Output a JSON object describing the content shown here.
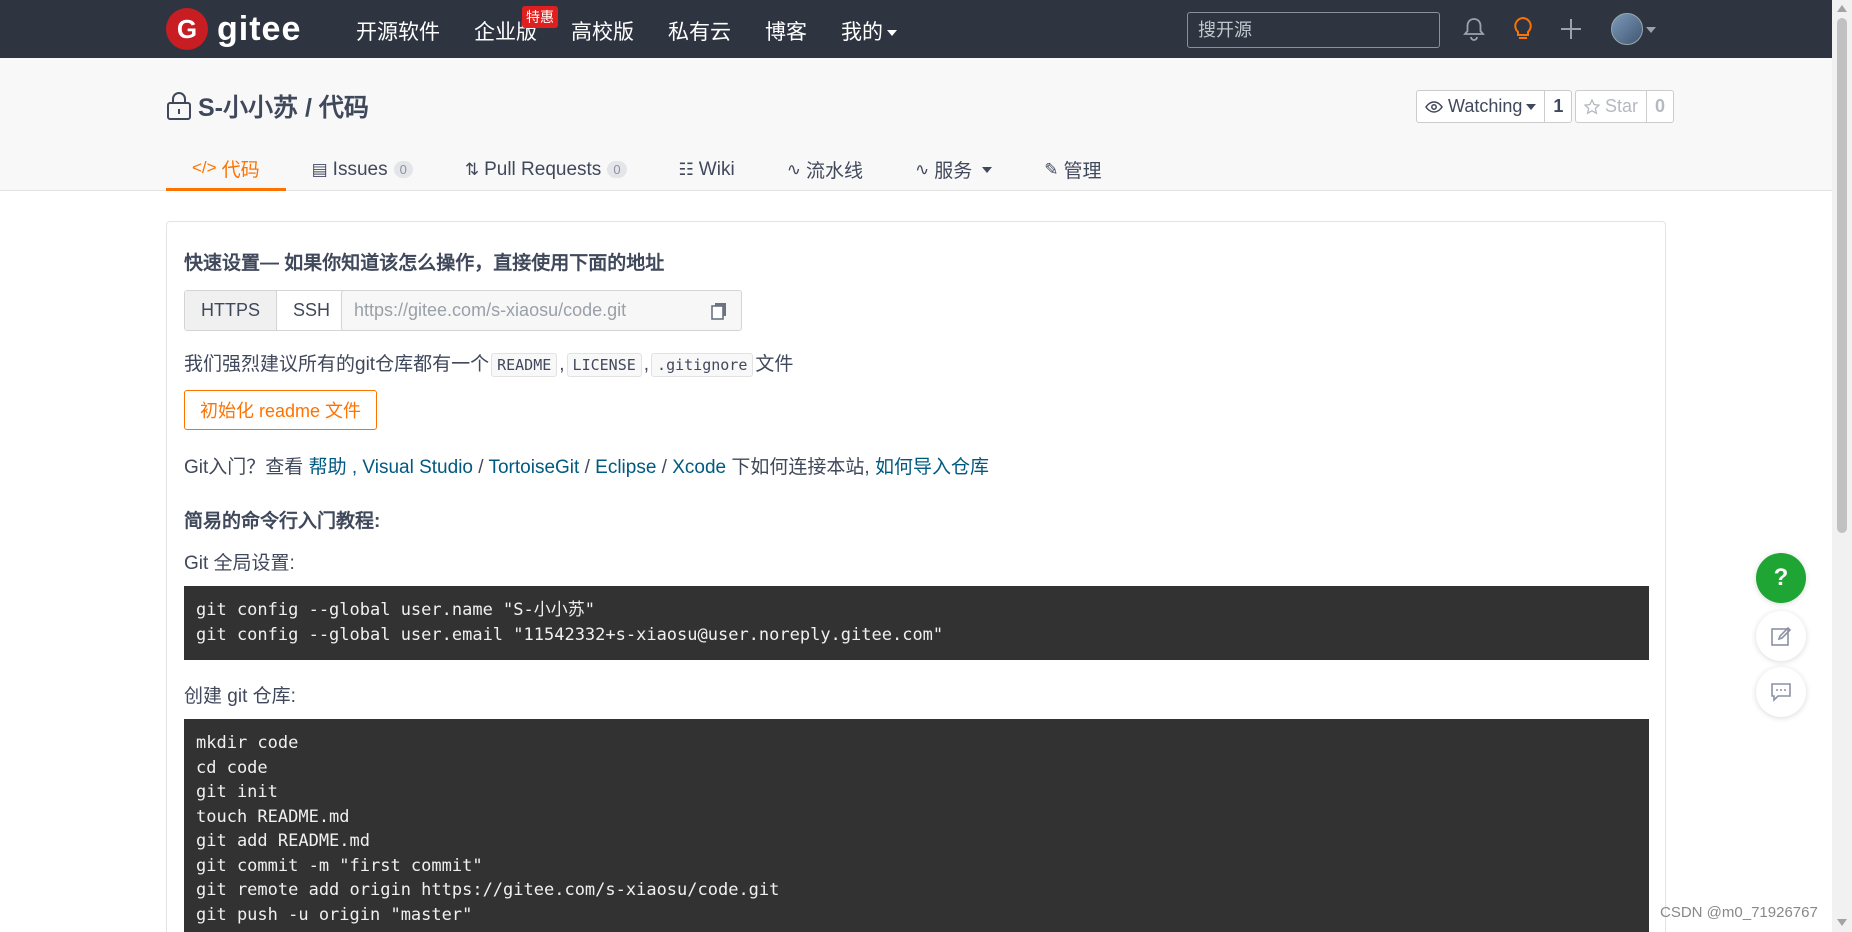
{
  "topnav": {
    "logo_text": "gitee",
    "logo_letter": "G",
    "links": [
      {
        "label": "开源软件"
      },
      {
        "label": "企业版",
        "badge": "特惠"
      },
      {
        "label": "高校版"
      },
      {
        "label": "私有云"
      },
      {
        "label": "博客"
      },
      {
        "label": "我的"
      }
    ],
    "search_placeholder": "搜开源"
  },
  "repo": {
    "title": "S-小小苏 / 代码",
    "watch_label": "Watching",
    "watch_count": "1",
    "star_label": "Star",
    "star_count": "0"
  },
  "tabs": [
    {
      "label": "代码",
      "icon": "code-icon",
      "active": true
    },
    {
      "label": "Issues",
      "count": "0",
      "icon": "issues-icon"
    },
    {
      "label": "Pull Requests",
      "count": "0",
      "icon": "pull-request-icon"
    },
    {
      "label": "Wiki",
      "icon": "wiki-icon"
    },
    {
      "label": "流水线",
      "icon": "pipeline-icon"
    },
    {
      "label": "服务",
      "icon": "service-icon"
    },
    {
      "label": "管理",
      "icon": "manage-icon"
    }
  ],
  "quick_setup": {
    "heading": "快速设置— 如果你知道该怎么操作，直接使用下面的地址",
    "https_label": "HTTPS",
    "ssh_label": "SSH",
    "url": "https://gitee.com/s-xiaosu/code.git",
    "recommend_prefix": "我们强烈建议所有的git仓库都有一个",
    "recommend_files": [
      "README",
      "LICENSE",
      ".gitignore"
    ],
    "recommend_suffix": "文件",
    "init_button": "初始化 readme 文件",
    "help_prefix": "Git入门？查看",
    "help_links": [
      "帮助",
      "Visual Studio",
      "TortoiseGit",
      "Eclipse",
      "Xcode"
    ],
    "help_mid": "下如何连接本站,",
    "import_link": "如何导入仓库"
  },
  "tutorial": {
    "heading": "简易的命令行入门教程:",
    "global_label": "Git 全局设置:",
    "global_lines": [
      "git config --global user.name \"S-小小苏\"",
      "git config --global user.email \"11542332+s-xiaosu@user.noreply.gitee.com\""
    ],
    "create_label": "创建 git 仓库:",
    "create_lines": [
      "mkdir code",
      "cd code",
      "git init",
      "touch README.md",
      "git add README.md",
      "git commit -m \"first commit\"",
      "git remote add origin https://gitee.com/s-xiaosu/code.git",
      "git push -u origin \"master\""
    ]
  },
  "floating": {
    "help_label": "?"
  },
  "watermark": "CSDN @m0_71926767",
  "colors": {
    "nav_bg": "#2e3541",
    "accent": "#fe7300",
    "brand": "#c71d23",
    "help_green": "#1ea533",
    "code_bg": "#323232"
  }
}
